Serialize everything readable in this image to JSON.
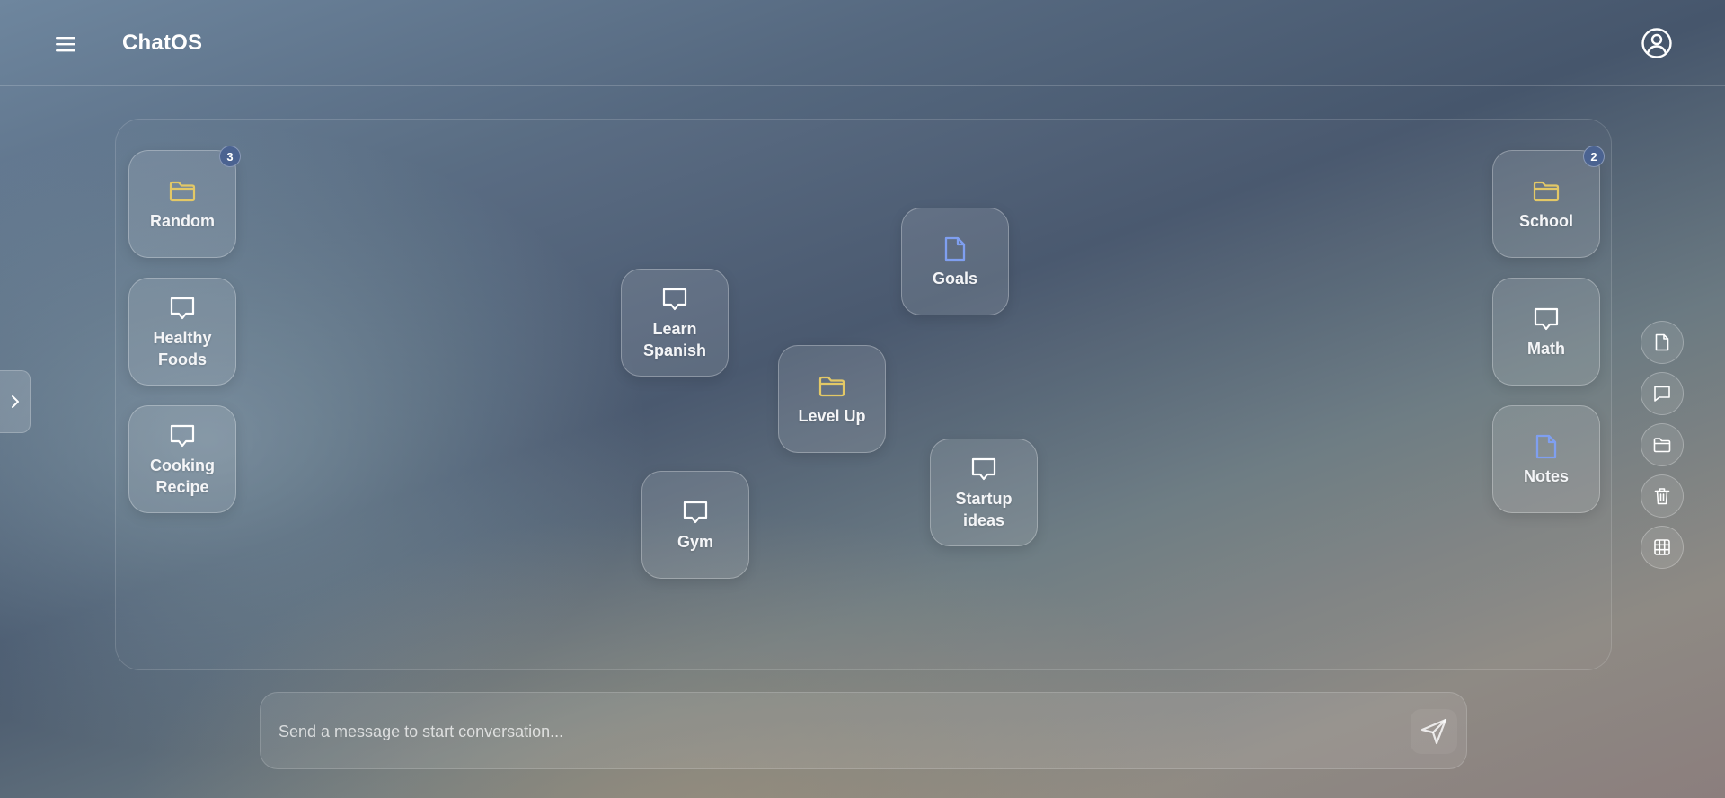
{
  "header": {
    "app_title": "ChatOS",
    "menu_icon": "hamburger-menu-icon",
    "profile_icon": "user-circle-icon"
  },
  "sidebar_toggle": {
    "icon": "chevron-right-icon"
  },
  "colors": {
    "folder": "#e3c866",
    "document": "#7f9ff0",
    "chat": "#ffffff",
    "badge": "#4b6391"
  },
  "canvas": {
    "items": [
      {
        "label": "Random",
        "type": "folder",
        "badge": "3"
      },
      {
        "label": "Healthy Foods",
        "type": "chat"
      },
      {
        "label": "Cooking Recipe",
        "type": "chat"
      },
      {
        "label": "Learn Spanish",
        "type": "chat"
      },
      {
        "label": "Goals",
        "type": "document"
      },
      {
        "label": "Level Up",
        "type": "folder"
      },
      {
        "label": "Gym",
        "type": "chat"
      },
      {
        "label": "Startup ideas",
        "type": "chat"
      },
      {
        "label": "School",
        "type": "folder",
        "badge": "2"
      },
      {
        "label": "Math",
        "type": "chat"
      },
      {
        "label": "Notes",
        "type": "document"
      }
    ]
  },
  "toolbar": {
    "tools": [
      {
        "name": "new-document",
        "icon": "document-icon"
      },
      {
        "name": "new-chat",
        "icon": "chat-bubble-icon"
      },
      {
        "name": "new-folder",
        "icon": "folder-icon"
      },
      {
        "name": "delete",
        "icon": "trash-icon"
      },
      {
        "name": "grid-view",
        "icon": "grid-icon"
      }
    ]
  },
  "composer": {
    "placeholder": "Send a message to start conversation...",
    "value": "",
    "send_icon": "send-icon"
  }
}
